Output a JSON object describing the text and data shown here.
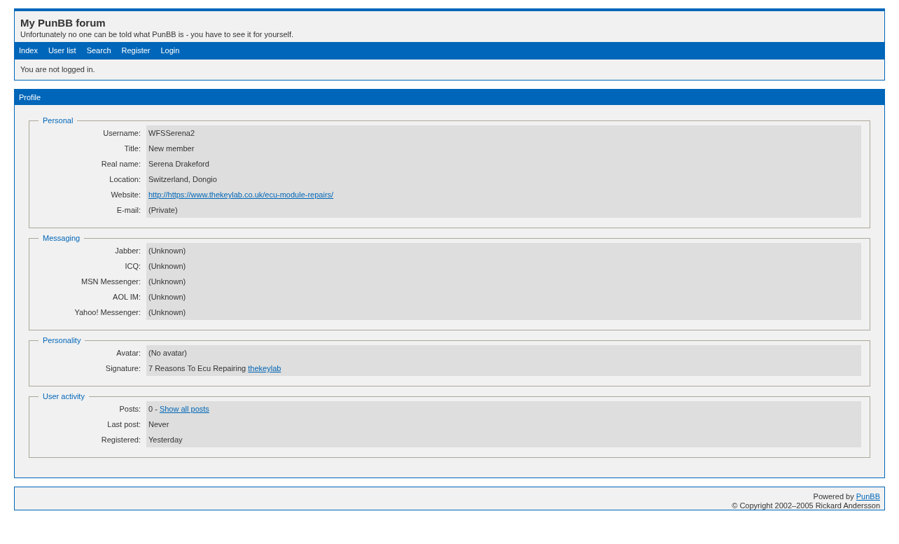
{
  "header": {
    "title": "My PunBB forum",
    "description": "Unfortunately no one can be told what PunBB is - you have to see it for yourself."
  },
  "nav": [
    "Index",
    "User list",
    "Search",
    "Register",
    "Login"
  ],
  "status": "You are not logged in.",
  "panel": {
    "title": "Profile",
    "sections": [
      {
        "legend": "Personal",
        "rows": [
          {
            "label": "Username:",
            "parts": [
              {
                "kind": "text",
                "text": "WFSSerena2"
              }
            ]
          },
          {
            "label": "Title:",
            "parts": [
              {
                "kind": "text",
                "text": "New member"
              }
            ]
          },
          {
            "label": "Real name:",
            "parts": [
              {
                "kind": "text",
                "text": "Serena Drakeford"
              }
            ]
          },
          {
            "label": "Location:",
            "parts": [
              {
                "kind": "text",
                "text": "Switzerland, Dongio"
              }
            ]
          },
          {
            "label": "Website:",
            "parts": [
              {
                "kind": "link",
                "text": "http://https://www.thekeylab.co.uk/ecu-module-repairs/"
              }
            ]
          },
          {
            "label": "E-mail:",
            "parts": [
              {
                "kind": "text",
                "text": "(Private)"
              }
            ]
          }
        ]
      },
      {
        "legend": "Messaging",
        "rows": [
          {
            "label": "Jabber:",
            "parts": [
              {
                "kind": "text",
                "text": "(Unknown)"
              }
            ]
          },
          {
            "label": "ICQ:",
            "parts": [
              {
                "kind": "text",
                "text": "(Unknown)"
              }
            ]
          },
          {
            "label": "MSN Messenger:",
            "parts": [
              {
                "kind": "text",
                "text": "(Unknown)"
              }
            ]
          },
          {
            "label": "AOL IM:",
            "parts": [
              {
                "kind": "text",
                "text": "(Unknown)"
              }
            ]
          },
          {
            "label": "Yahoo! Messenger:",
            "parts": [
              {
                "kind": "text",
                "text": "(Unknown)"
              }
            ]
          }
        ]
      },
      {
        "legend": "Personality",
        "rows": [
          {
            "label": "Avatar:",
            "parts": [
              {
                "kind": "text",
                "text": "(No avatar)"
              }
            ]
          },
          {
            "label": "Signature:",
            "parts": [
              {
                "kind": "text",
                "text": "7 Reasons To Ecu Repairing"
              },
              {
                "kind": "link",
                "text": "thekeylab"
              }
            ]
          }
        ]
      },
      {
        "legend": "User activity",
        "rows": [
          {
            "label": "Posts:",
            "parts": [
              {
                "kind": "text",
                "text": "0 -"
              },
              {
                "kind": "link",
                "text": "Show all posts"
              }
            ]
          },
          {
            "label": "Last post:",
            "parts": [
              {
                "kind": "text",
                "text": "Never"
              }
            ]
          },
          {
            "label": "Registered:",
            "parts": [
              {
                "kind": "text",
                "text": "Yesterday"
              }
            ]
          }
        ]
      }
    ]
  },
  "footer": {
    "powered_by": "Powered by",
    "powered_link": "PunBB",
    "copyright": "© Copyright 2002–2005 Rickard Andersson"
  }
}
